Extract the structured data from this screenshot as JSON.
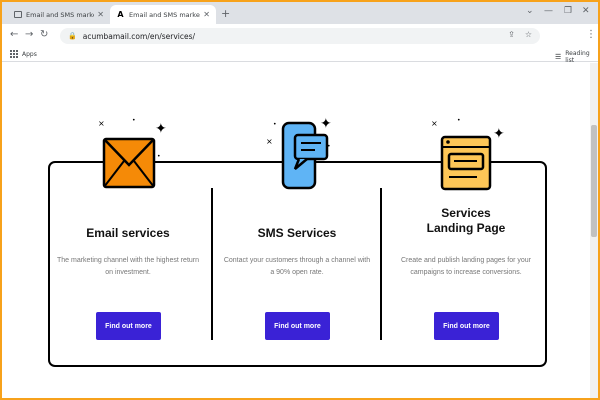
{
  "browser": {
    "tabs": [
      {
        "title": "Email and SMS marketing made",
        "active": false
      },
      {
        "title": "Email and SMS marketing made",
        "active": true
      }
    ],
    "favicon_letter": "A",
    "url": "acumbamail.com/en/services/",
    "bookmarks": {
      "apps_label": "Apps",
      "reading_list_label": "Reading list"
    }
  },
  "services": [
    {
      "title_line1": "Email services",
      "title_line2": "",
      "description": "The marketing channel with the highest return on investment.",
      "button_label": "Find out more",
      "icon": "envelope-icon"
    },
    {
      "title_line1": "SMS Services",
      "title_line2": "",
      "description": "Contact your customers through a channel with a 90% open rate.",
      "button_label": "Find out more",
      "icon": "phone-message-icon"
    },
    {
      "title_line1": "Services",
      "title_line2": "Landing Page",
      "description": "Create and publish landing pages for your campaigns to increase conversions.",
      "button_label": "Find out more",
      "icon": "landing-page-icon"
    }
  ],
  "colors": {
    "frame_border": "#f7a21b",
    "button": "#3a22d6",
    "envelope": "#f58a07",
    "phone": "#5fb4f5",
    "landing": "#fdc657"
  }
}
